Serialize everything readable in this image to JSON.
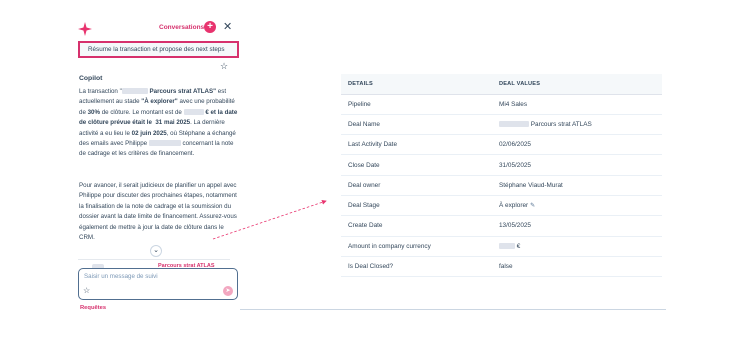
{
  "colors": {
    "accent": "#d6316d",
    "text": "#33475b",
    "table_header_bg": "#f5f8fa"
  },
  "header": {
    "logo_icon": "sparkle-icon",
    "conversations_label": "Conversations",
    "new_label": "+",
    "close_label": "✕"
  },
  "prompt": {
    "text": "Résume la transaction et propose des next steps",
    "star_icon": "star-outline-icon"
  },
  "copilot": {
    "title": "Copilot",
    "p1": {
      "t1": "La transaction \"",
      "t2": " Parcours strat ATLAS\"",
      "t3": " est actuellement au stade ",
      "stage": "\"À explorer\"",
      "t4": " avec une probabilité de ",
      "prob": "30%",
      "t5": " de clôture. Le montant est de ",
      "t6": " € et la date de clôture prévue était le ",
      "close_date": "31 mai 2025",
      "t7": ". La dernière activité a eu lieu le ",
      "last_date": "02 juin 2025",
      "t8": ", où Stéphane a échangé des emails avec Philippe ",
      "t9": " concernant la note de cadrage et les critères de financement."
    },
    "p2": "Pour avancer, il serait judicieux de planifier un appel avec Philippe pour discuter des prochaines étapes, notamment la finalisation de la note de cadrage et la soumission du dossier avant la date limite de financement. Assurez-vous également de mettre à jour la date de clôture dans le CRM.",
    "card_text": "Parcours strat ATLAS",
    "chevron_icon": "chevron-down-icon"
  },
  "reply": {
    "placeholder": "Saisir un message de suivi",
    "star_icon": "star-outline-icon",
    "send_icon": "send-icon"
  },
  "footer": {
    "requetes_label": "Requêtes"
  },
  "table": {
    "headers": [
      "DETAILS",
      "DEAL VALUES"
    ],
    "rows": [
      {
        "field": "Pipeline",
        "value": "Mi4 Sales"
      },
      {
        "field": "Deal Name",
        "value": "Parcours strat ATLAS"
      },
      {
        "field": "Last Activity Date",
        "value": "02/06/2025"
      },
      {
        "field": "Close Date",
        "value": "31/05/2025"
      },
      {
        "field": "Deal owner",
        "value": "Stéphane Viaud-Murat"
      },
      {
        "field": "Deal Stage",
        "value": "À explorer"
      },
      {
        "field": "Create Date",
        "value": "13/05/2025"
      },
      {
        "field": "Amount in company currency",
        "value": "€"
      },
      {
        "field": "Is Deal Closed?",
        "value": "false"
      }
    ]
  }
}
